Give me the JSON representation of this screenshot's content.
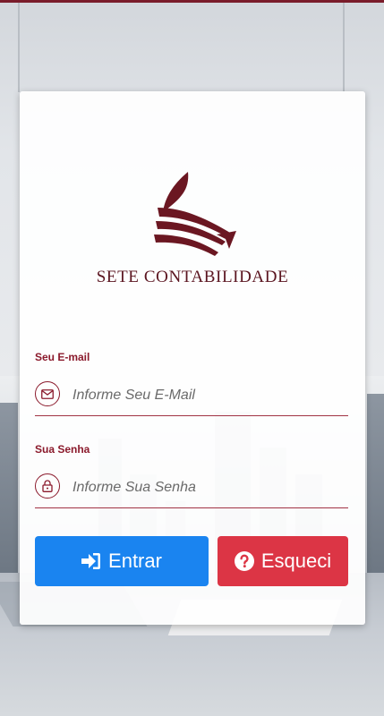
{
  "brand": {
    "name": "SETE CONTABILIDADE",
    "color": "#5b1520"
  },
  "form": {
    "email": {
      "label": "Seu E-mail",
      "placeholder": "Informe Seu E-Mail",
      "value": "",
      "icon": "envelope-icon"
    },
    "password": {
      "label": "Sua Senha",
      "placeholder": "Informe Sua Senha",
      "value": "",
      "icon": "lock-icon"
    }
  },
  "buttons": {
    "login": {
      "label": "Entrar",
      "icon": "sign-in-icon",
      "color": "#1a84f0"
    },
    "forgot": {
      "label": "Esqueci",
      "icon": "question-circle-icon",
      "color": "#dc3545"
    }
  },
  "colors": {
    "accent": "#8b1a2c"
  }
}
